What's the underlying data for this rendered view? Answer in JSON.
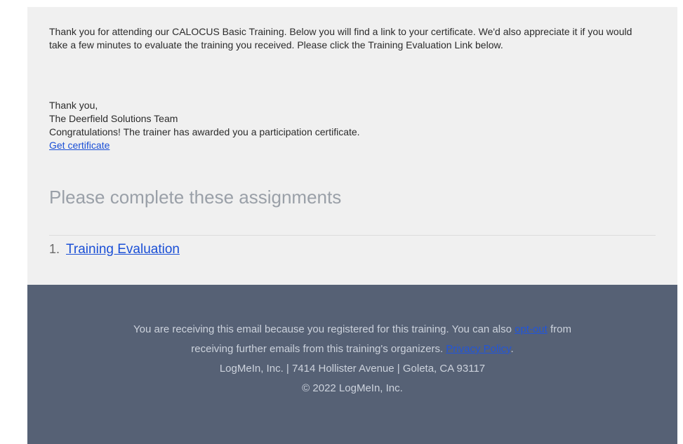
{
  "intro": {
    "paragraph": "Thank you for attending our CALOCUS Basic Training. Below you will find a link to your certificate. We'd also appreciate it if you would take a few minutes to evaluate the training you received. Please click the Training Evaluation Link below."
  },
  "signature": {
    "thanks": "Thank you,",
    "team": "The Deerfield Solutions Team",
    "congrats": "Congratulations! The trainer has awarded you a participation certificate.",
    "certificate_link": "Get certificate"
  },
  "assignments": {
    "heading": "Please complete these assignments",
    "items": [
      {
        "number": "1.",
        "label": "Training Evaluation"
      }
    ]
  },
  "footer": {
    "line1_a": "You are receiving this email because you registered for this training. You can also ",
    "optout_link": "opt-out",
    "line1_b": " from",
    "line2_a": "receiving further emails from this training's organizers. ",
    "privacy_link": "Privacy Policy",
    "line2_b": ".",
    "address": "LogMeIn, Inc. | 7414 Hollister Avenue | Goleta, CA 93117",
    "copyright": "© 2022 LogMeIn, Inc."
  },
  "colors": {
    "card_bg": "#f0f0f0",
    "footer_bg": "#566175",
    "link": "#1a4fd6",
    "heading": "#9aa0a8"
  }
}
